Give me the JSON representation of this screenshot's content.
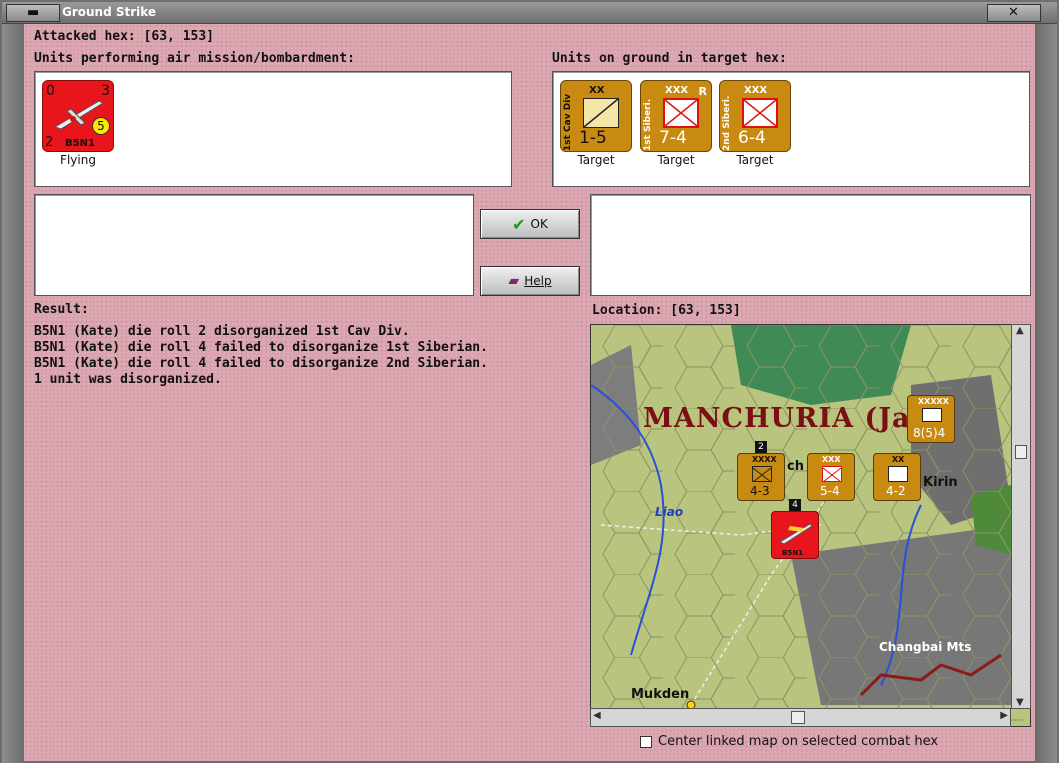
{
  "window": {
    "title": "Ground Strike"
  },
  "header": {
    "attacked_hex": "Attacked hex:  [63, 153]",
    "air_units_heading": "Units performing air mission/bombardment:",
    "ground_units_heading": "Units on ground in target hex:"
  },
  "air_units": [
    {
      "name": "B5N1",
      "attack": "0",
      "defense": "2",
      "range": "3",
      "strength": "5",
      "status": "Flying",
      "color": "#e8151c"
    }
  ],
  "ground_units": [
    {
      "name": "1st Cav Div",
      "size": "XX",
      "type": "cavalry",
      "stats": "1-5",
      "status": "Target",
      "reserve": ""
    },
    {
      "name": "1st Siberi.",
      "size": "XXX",
      "type": "infantry",
      "stats": "7-4",
      "status": "Target",
      "reserve": "R"
    },
    {
      "name": "2nd Siberi.",
      "size": "XXX",
      "type": "infantry",
      "stats": "6-4",
      "status": "Target",
      "reserve": ""
    }
  ],
  "buttons": {
    "ok_label": "OK",
    "help_label": "Help"
  },
  "result": {
    "heading": "Result:",
    "lines": [
      "B5N1 (Kate) die roll 2 disorganized 1st Cav Div.",
      "B5N1 (Kate) die roll 4 failed to disorganize 1st Siberian.",
      "B5N1 (Kate) die roll 4 failed to disorganize 2nd Siberian.",
      "1 unit was disorganized."
    ]
  },
  "location": {
    "heading": "Location:  [63, 153]"
  },
  "map": {
    "region_label": "MANCHURIA (Ja)",
    "places": [
      "Liao",
      "Kirin",
      "Changbai Mts",
      "Mukden",
      "ch"
    ],
    "map_units": [
      {
        "stats": "8(5)4",
        "size": "XXXXX"
      },
      {
        "stats": "4-3",
        "size": "XXXX",
        "stack": "2"
      },
      {
        "stats": "5-4",
        "size": "XXX"
      },
      {
        "stats": "4-2",
        "size": "XX"
      },
      {
        "stats": "B5N1",
        "stack": "4"
      }
    ]
  },
  "footer": {
    "center_map_label": "Center linked map on selected combat hex",
    "center_map_checked": false
  },
  "colors": {
    "background": "#d9a3ad",
    "air_unit": "#e8151c",
    "ground_unit": "#c98a12",
    "region_label": "#7a0f14"
  }
}
